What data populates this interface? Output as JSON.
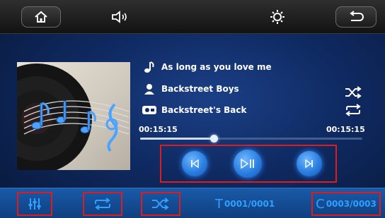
{
  "top_bar": {
    "buttons": [
      "home",
      "volume",
      "brightness",
      "back"
    ]
  },
  "track": {
    "title": "As long as you love me",
    "artist": "Backstreet Boys",
    "album": "Backstreet's Back"
  },
  "time": {
    "elapsed": "00:15:15",
    "total": "00:15:15",
    "progress_fraction": 0.33
  },
  "bottom_bar": {
    "track_counter": "0001/0001",
    "track_letter": "T",
    "folder_counter": "0003/0003",
    "folder_letter": "C"
  },
  "colors": {
    "accent": "#2fa0ff",
    "highlight_box": "#e11b1b"
  }
}
